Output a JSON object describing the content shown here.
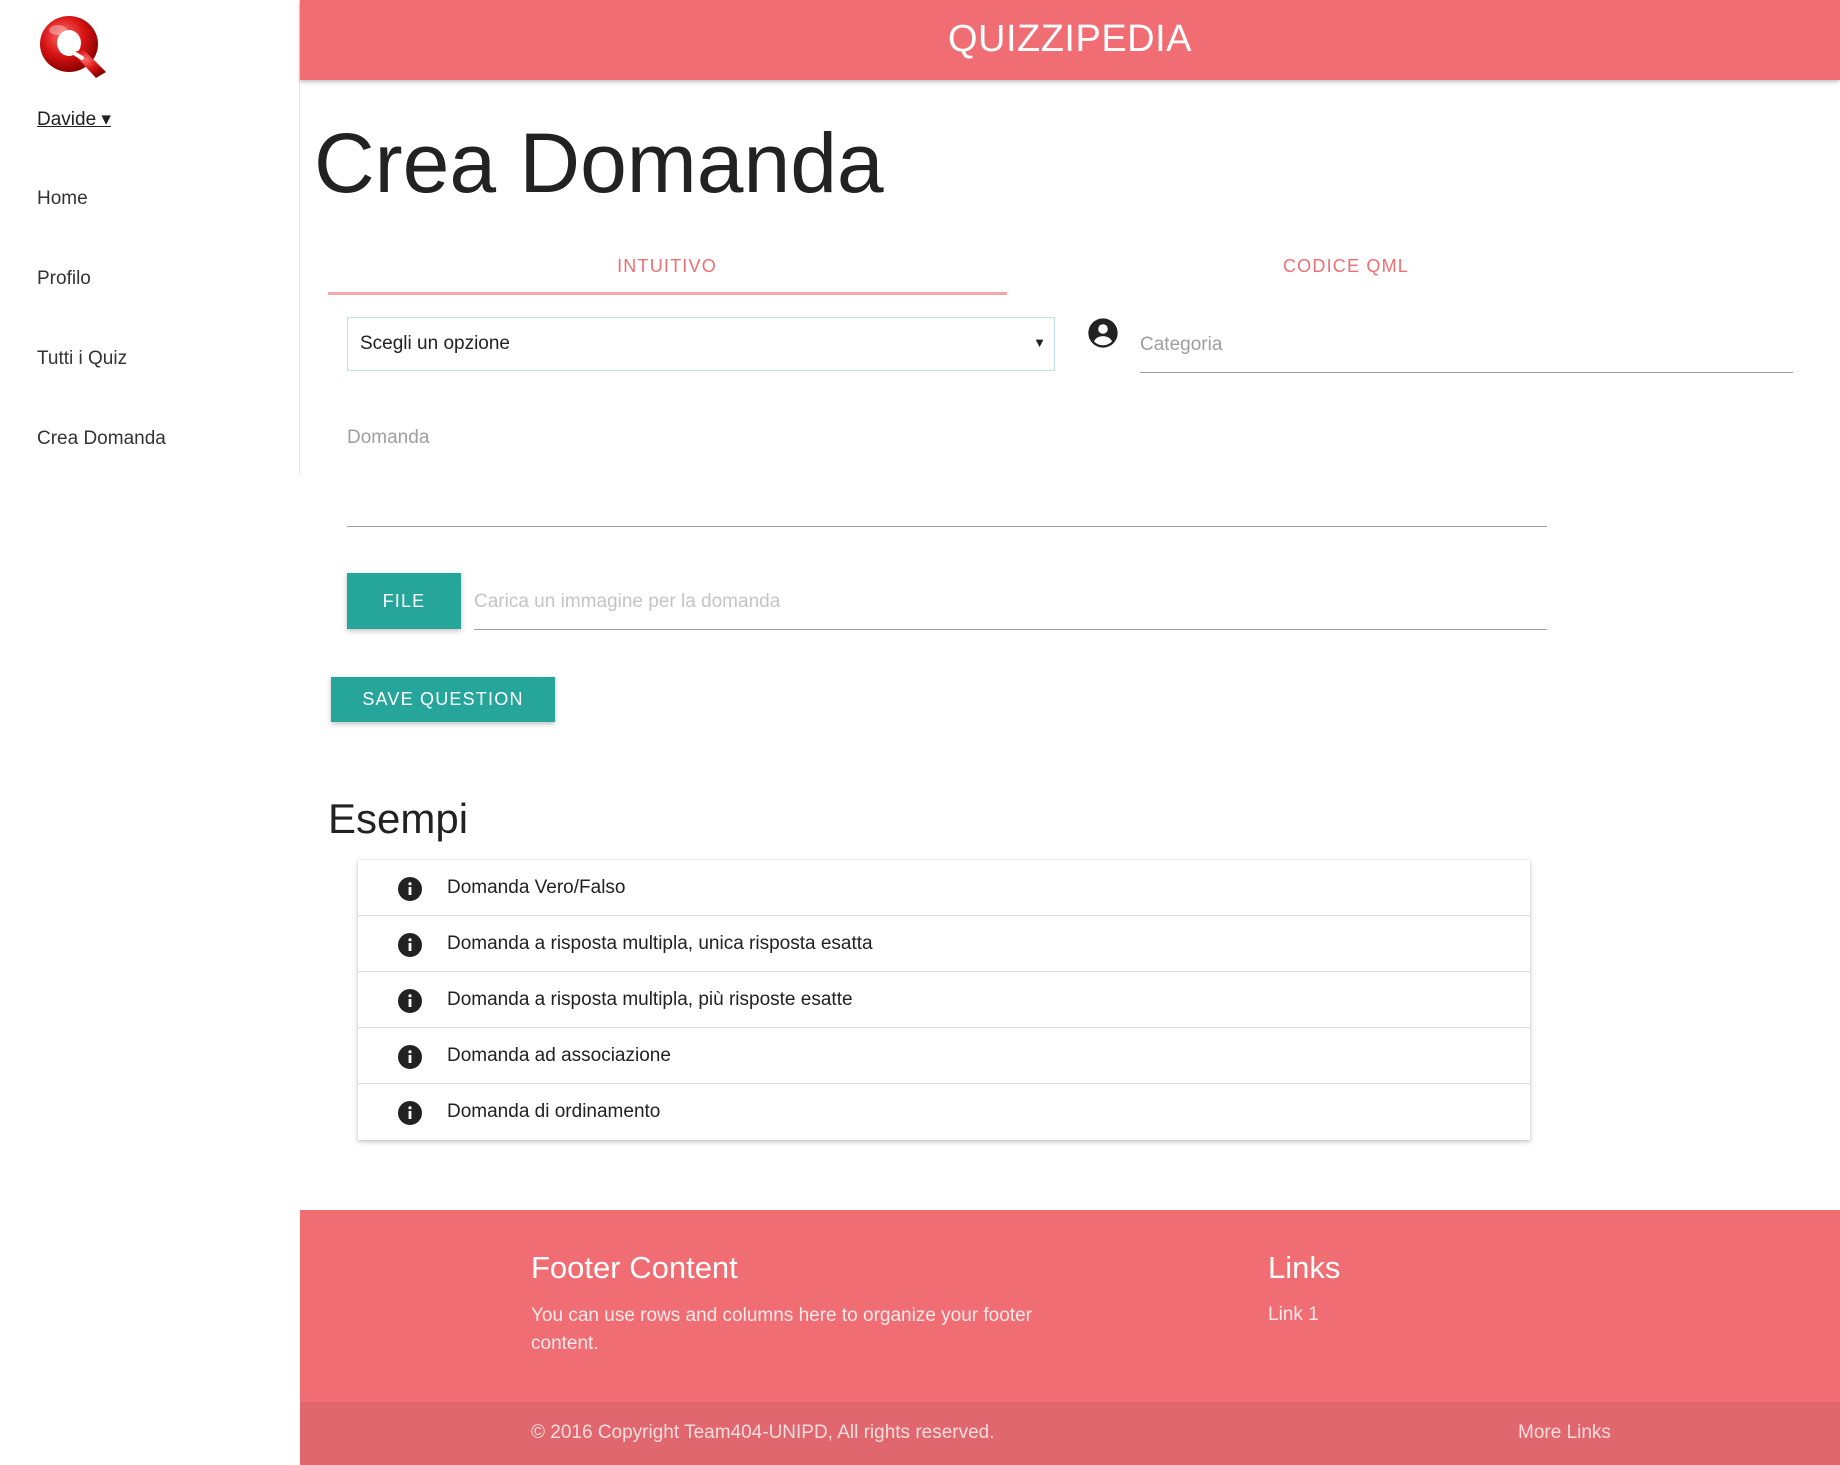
{
  "header": {
    "title": "QUIZZIPEDIA"
  },
  "sidebar": {
    "user": "Davide ▾",
    "items": [
      {
        "label": "Home"
      },
      {
        "label": "Profilo"
      },
      {
        "label": "Tutti i Quiz"
      },
      {
        "label": "Crea Domanda"
      }
    ]
  },
  "main": {
    "title": "Crea Domanda",
    "tabs": [
      {
        "label": "INTUITIVO",
        "active": true
      },
      {
        "label": "CODICE QML",
        "active": false
      }
    ],
    "select": {
      "selected": "Scegli un opzione"
    },
    "categoria": {
      "placeholder": "Categoria"
    },
    "domanda": {
      "label": "Domanda"
    },
    "file": {
      "button_label": "FILE",
      "placeholder": "Carica un immagine per la domanda"
    },
    "save_label": "SAVE QUESTION"
  },
  "esempi": {
    "title": "Esempi",
    "items": [
      {
        "label": "Domanda Vero/Falso"
      },
      {
        "label": "Domanda a risposta multipla, unica risposta esatta"
      },
      {
        "label": "Domanda a risposta multipla, più risposte esatte"
      },
      {
        "label": "Domanda ad associazione"
      },
      {
        "label": "Domanda di ordinamento"
      }
    ]
  },
  "footer": {
    "content_title": "Footer Content",
    "content_text": "You can use rows and columns here to organize your footer content.",
    "links_title": "Links",
    "link_1": "Link 1",
    "copyright": "© 2016 Copyright Team404-UNIPD, All rights reserved.",
    "more_links": "More Links"
  },
  "colors": {
    "brand": "#ef6d73",
    "accent": "#26a69a",
    "footer_bottom": "#e0676d"
  }
}
